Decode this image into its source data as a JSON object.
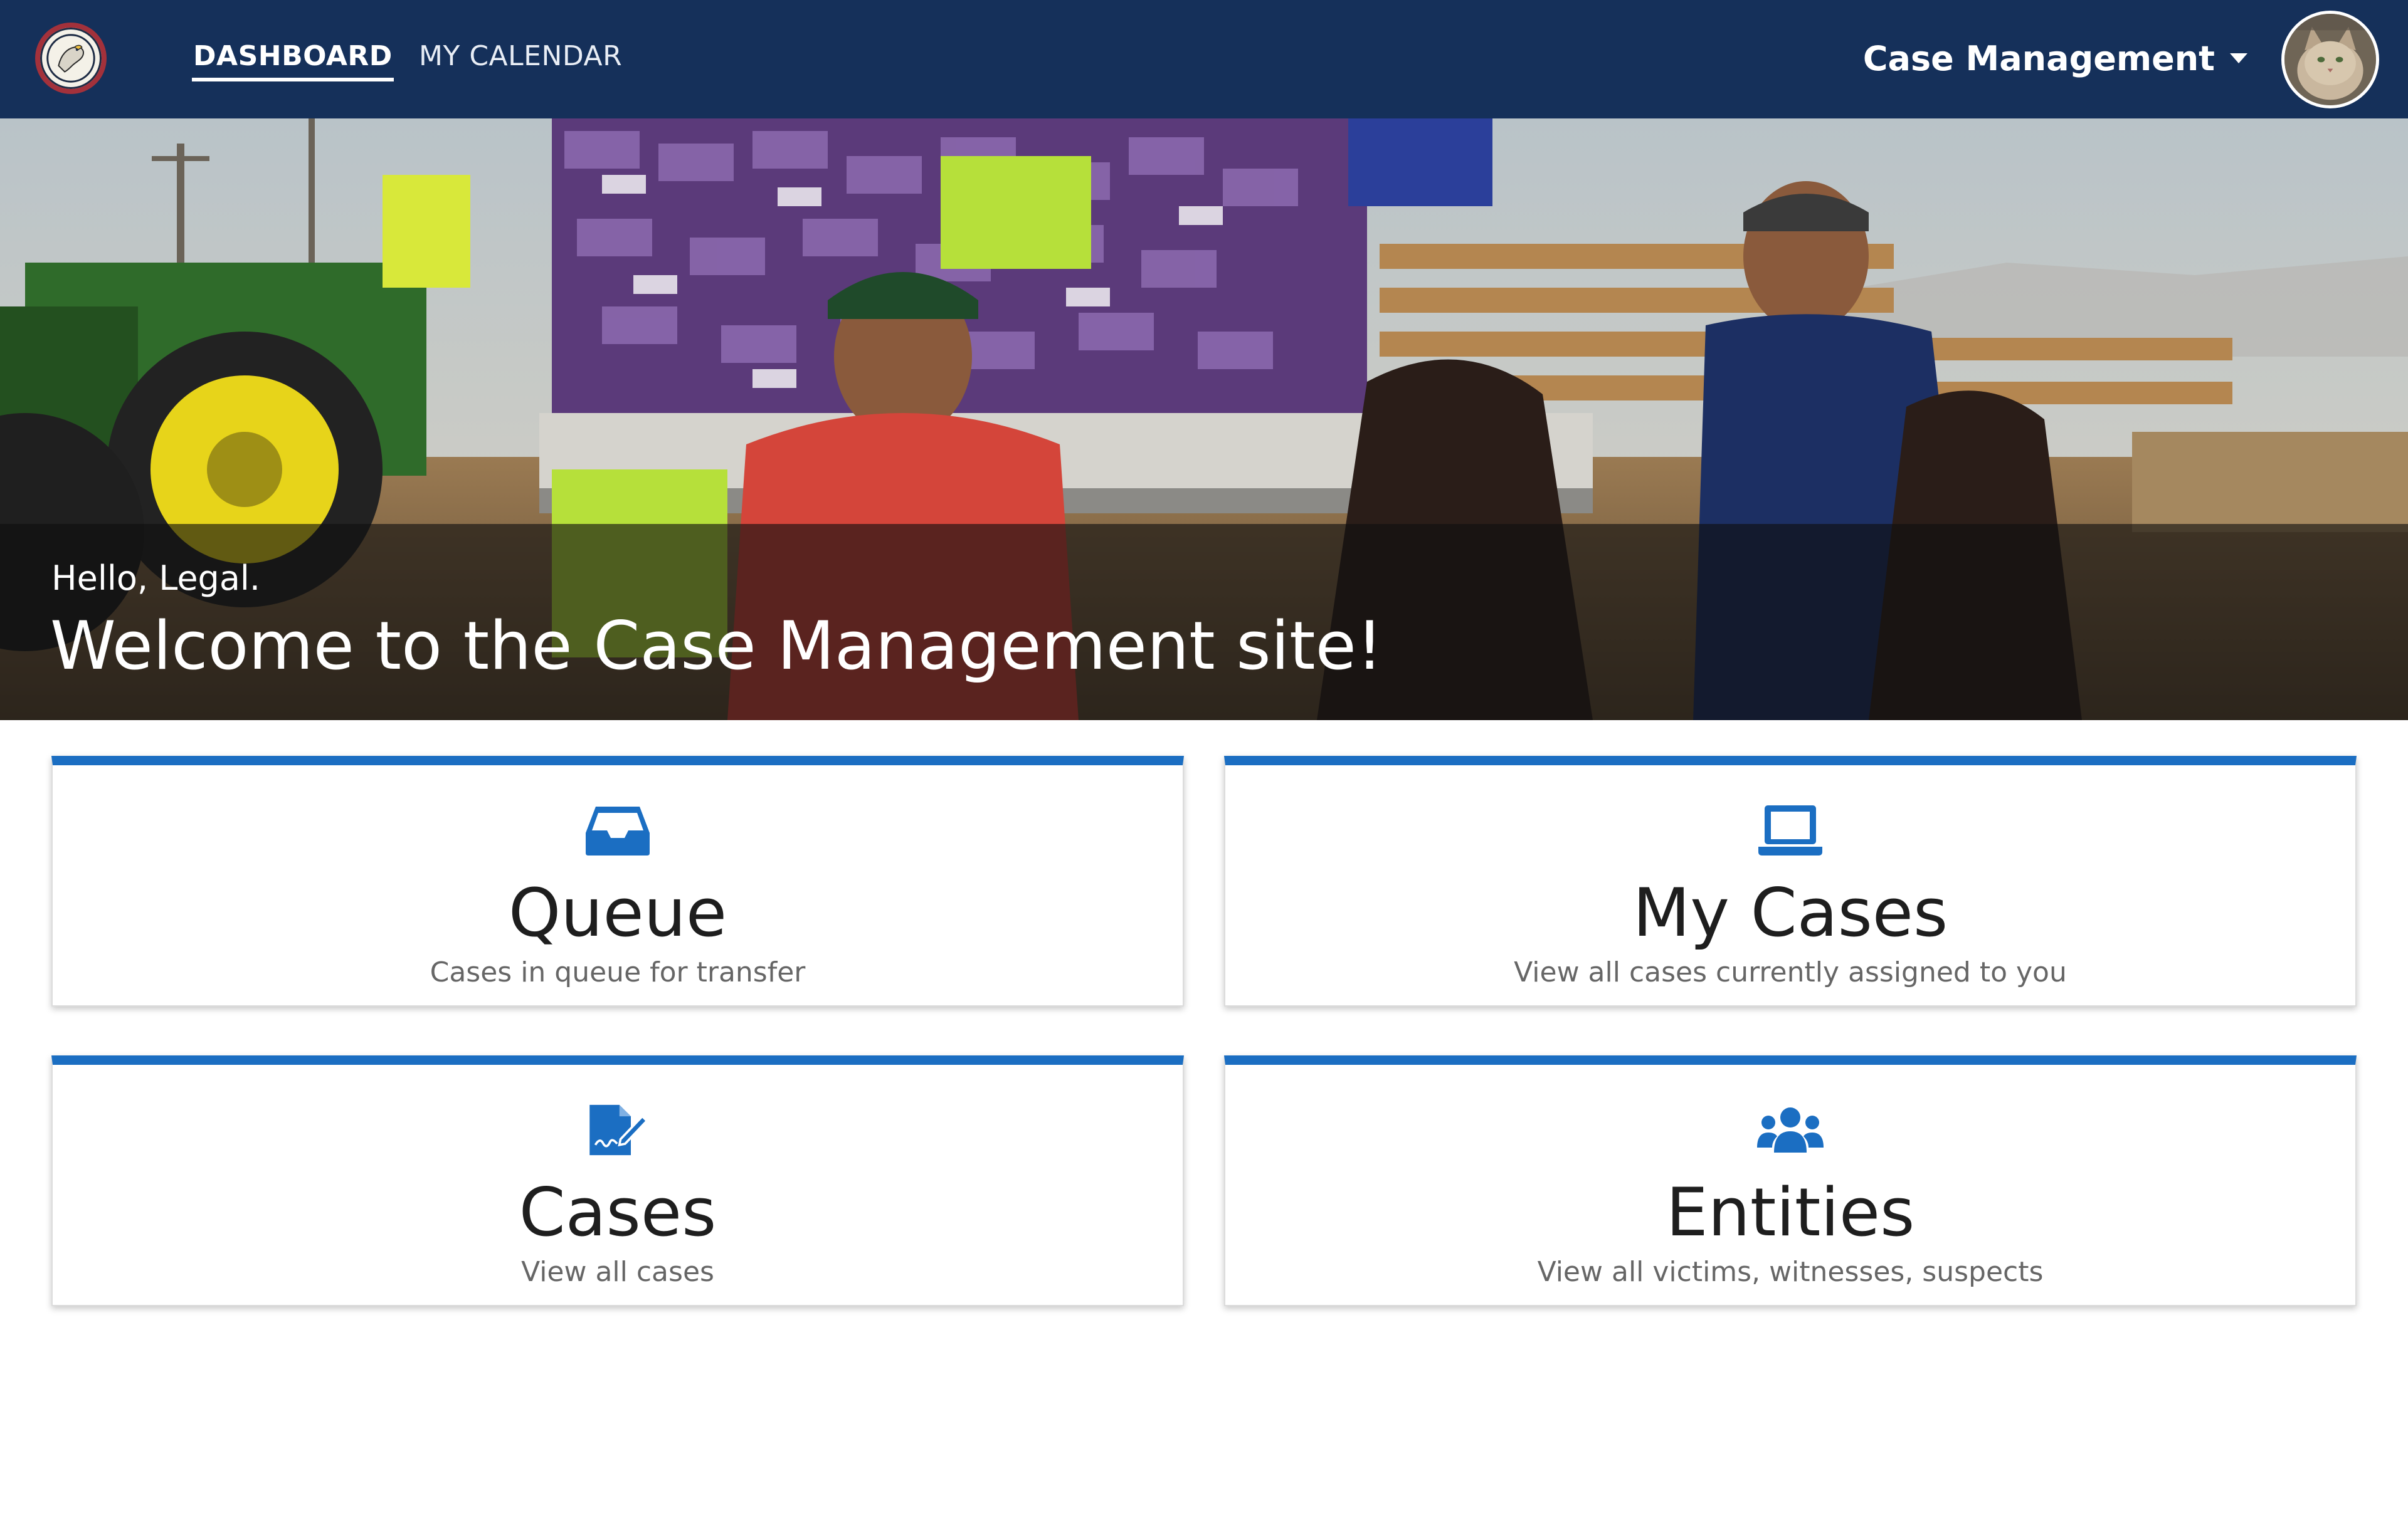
{
  "nav": {
    "logo_icon": "eagle-seal-icon",
    "links": [
      {
        "label": "DASHBOARD",
        "active": true
      },
      {
        "label": "MY CALENDAR",
        "active": false
      }
    ],
    "app_switcher": {
      "label": "Case Management",
      "icon": "caret-down-icon"
    },
    "avatar_icon": "user-avatar"
  },
  "hero": {
    "greeting": "Hello, Legal.",
    "title": "Welcome to the Case Management site!"
  },
  "cards": [
    {
      "title": "Queue",
      "subtitle": "Cases in queue for transfer",
      "icon": "inbox-icon"
    },
    {
      "title": "My Cases",
      "subtitle": "View all cases currently assigned to you",
      "icon": "laptop-icon"
    },
    {
      "title": "Cases",
      "subtitle": "View all cases",
      "icon": "file-signature-icon"
    },
    {
      "title": "Entities",
      "subtitle": "View all victims, witnesses, suspects",
      "icon": "users-icon"
    }
  ],
  "colors": {
    "navbar": "#15305a",
    "accent": "#1b6ec2",
    "card_title": "#1e1e1e",
    "card_subtitle": "#666666"
  }
}
